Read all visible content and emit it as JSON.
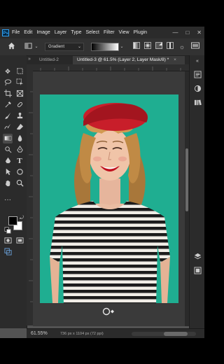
{
  "menu": {
    "logo": "Ps",
    "items": [
      "File",
      "Edit",
      "Image",
      "Layer",
      "Type",
      "Select",
      "Filter",
      "View",
      "Plugin"
    ],
    "window_controls": [
      "—",
      "□",
      "✕"
    ]
  },
  "options": {
    "gradient_label": "Gradient"
  },
  "tabs": {
    "tab1": "Untitled-2",
    "tab2": "Untitled-3 @ 61.5% (Layer 2, Layer Mask/8) *",
    "close": "×"
  },
  "status": {
    "zoom": "61.55%",
    "doc_info": "736 px x 1104 px (72 ppi)"
  },
  "icons": {
    "home": "home-icon",
    "move": "move-tool-icon",
    "marquee": "rectangular-marquee-icon",
    "lasso": "lasso-icon",
    "crop": "crop-icon",
    "brush": "brush-icon",
    "stamp": "clone-stamp-icon",
    "eraser": "eraser-icon",
    "gradient": "gradient-tool-icon",
    "pen": "pen-icon",
    "type": "type-tool-icon",
    "hand": "hand-icon",
    "zoom": "zoom-icon"
  },
  "colors": {
    "canvas_bg": "#1fae91",
    "hat": "#c81e2a",
    "workspace": "#3a3a3a",
    "panel": "#2b2b2b",
    "foreground_color": "#000000",
    "background_color": "#ffffff"
  }
}
